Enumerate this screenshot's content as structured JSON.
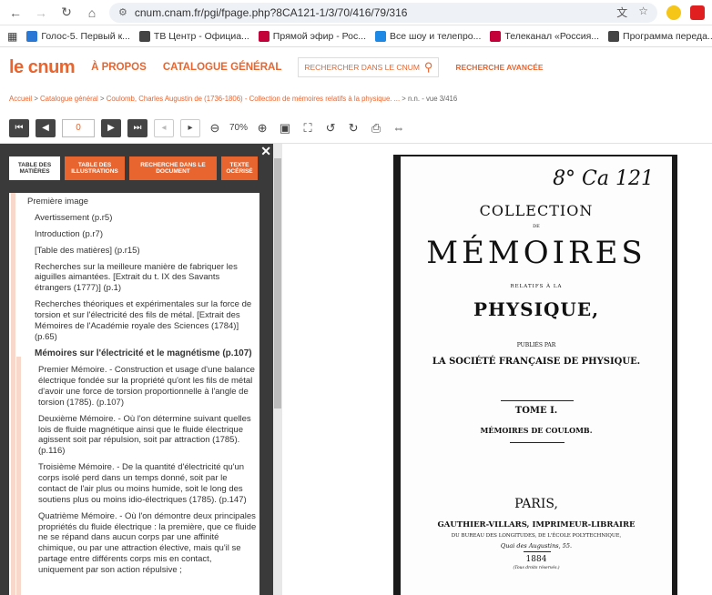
{
  "browser": {
    "url": "cnum.cnam.fr/pgi/fpage.php?8CA121-1/3/70/416/79/316",
    "bookmarks": [
      "Голос-5. Первый к...",
      "ТВ Центр - Официа...",
      "Прямой эфир - Рос...",
      "Все шоу и телепро...",
      "Телеканал «Россия...",
      "Программа переда..."
    ],
    "bookmark_badges": [
      "VK",
      "TBC",
      "",
      "",
      "",
      "TBC"
    ],
    "bookmark_colors": [
      "#2a78d6",
      "#444444",
      "#c4003b",
      "#1e88e5",
      "#c4003b",
      "#444444"
    ]
  },
  "site": {
    "logo_main": "le",
    "logo_cnum": "cnum",
    "nav_about": "À PROPOS",
    "nav_catalogue": "CATALOGUE GÉNÉRAL",
    "search_placeholder": "RECHERCHER DANS LE CNUM",
    "advanced_search": "RECHERCHE AVANCÉE",
    "accent_color": "#e8652f"
  },
  "breadcrumb": {
    "links": [
      "Accueil",
      "Catalogue général",
      "Coulomb, Charles Augustin de (1736-1806) - Collection de mémoires relatifs à la physique. ..."
    ],
    "tail": "n.n. - vue 3/416"
  },
  "toolbar": {
    "page_value": "0",
    "zoom": "70%"
  },
  "sidebar": {
    "tabs": [
      "TABLE DES MATIÈRES",
      "TABLE DES ILLUSTRATIONS",
      "RECHERCHE DANS LE DOCUMENT",
      "TEXTE OCÉRISÉ"
    ],
    "close": "✕",
    "toc": [
      {
        "text": "Première image",
        "level": 0
      },
      {
        "text": "Avertissement (p.r5)",
        "level": 1
      },
      {
        "text": "Introduction (p.r7)",
        "level": 1
      },
      {
        "text": "[Table des matières] (p.r15)",
        "level": 1
      },
      {
        "text": "Recherches sur la meilleure manière de fabriquer les aiguilles aimantées. [Extrait du t. IX des Savants étrangers (1777)] (p.1)",
        "level": 1
      },
      {
        "text": "Recherches théoriques et expérimentales sur la force de torsion et sur l'électricité des fils de métal. [Extrait des Mémoires de l'Académie royale des Sciences (1784)] (p.65)",
        "level": 1
      },
      {
        "text": "Mémoires sur l'électricité et le magnétisme (p.107)",
        "level": 1,
        "bold": true
      },
      {
        "text": "Premier Mémoire. - Construction et usage d'une balance électrique fondée sur la propriété qu'ont les fils de métal d'avoir une force de torsion proportionnelle à l'angle de torsion (1785). (p.107)",
        "level": 2
      },
      {
        "text": "Deuxième Mémoire. - Où l'on détermine suivant quelles lois de fluide magnétique ainsi que le fluide électrique agissent soit par répulsion, soit par attraction (1785). (p.116)",
        "level": 2
      },
      {
        "text": "Troisième Mémoire. - De la quantité d'électricité qu'un corps isolé perd dans un temps donné, soit par le contact de l'air plus ou moins humide, soit le long des soutiens plus ou moins idio-électriques (1785). (p.147)",
        "level": 2
      },
      {
        "text": "Quatrième Mémoire. - Où l'on démontre deux principales propriétés du fluide électrique : la première, que ce fluide ne se répand dans aucun corps par une affinité chimique, ou par une attraction élective, mais qu'il se partage entre différents corps mis en contact, uniquement par son action répulsive ;",
        "level": 2
      }
    ]
  },
  "document_page": {
    "handwritten": "8° Ca 121",
    "collection": "COLLECTION",
    "de": "DE",
    "memoires": "MÉMOIRES",
    "relatifs": "RELATIFS À LA",
    "physique": "PHYSIQUE,",
    "publies": "PUBLIÉS PAR",
    "societe": "LA SOCIÉTÉ FRANÇAISE DE PHYSIQUE.",
    "tome": "TOME I.",
    "coulomb": "MÉMOIRES DE COULOMB.",
    "paris": "PARIS,",
    "publisher": "GAUTHIER-VILLARS, IMPRIMEUR-LIBRAIRE",
    "bureau": "DU BUREAU DES LONGITUDES, DE L'ÉCOLE POLYTECHNIQUE,",
    "quai": "Quai des Augustins, 55.",
    "year": "1884",
    "rights": "(Tous droits réservés.)"
  }
}
